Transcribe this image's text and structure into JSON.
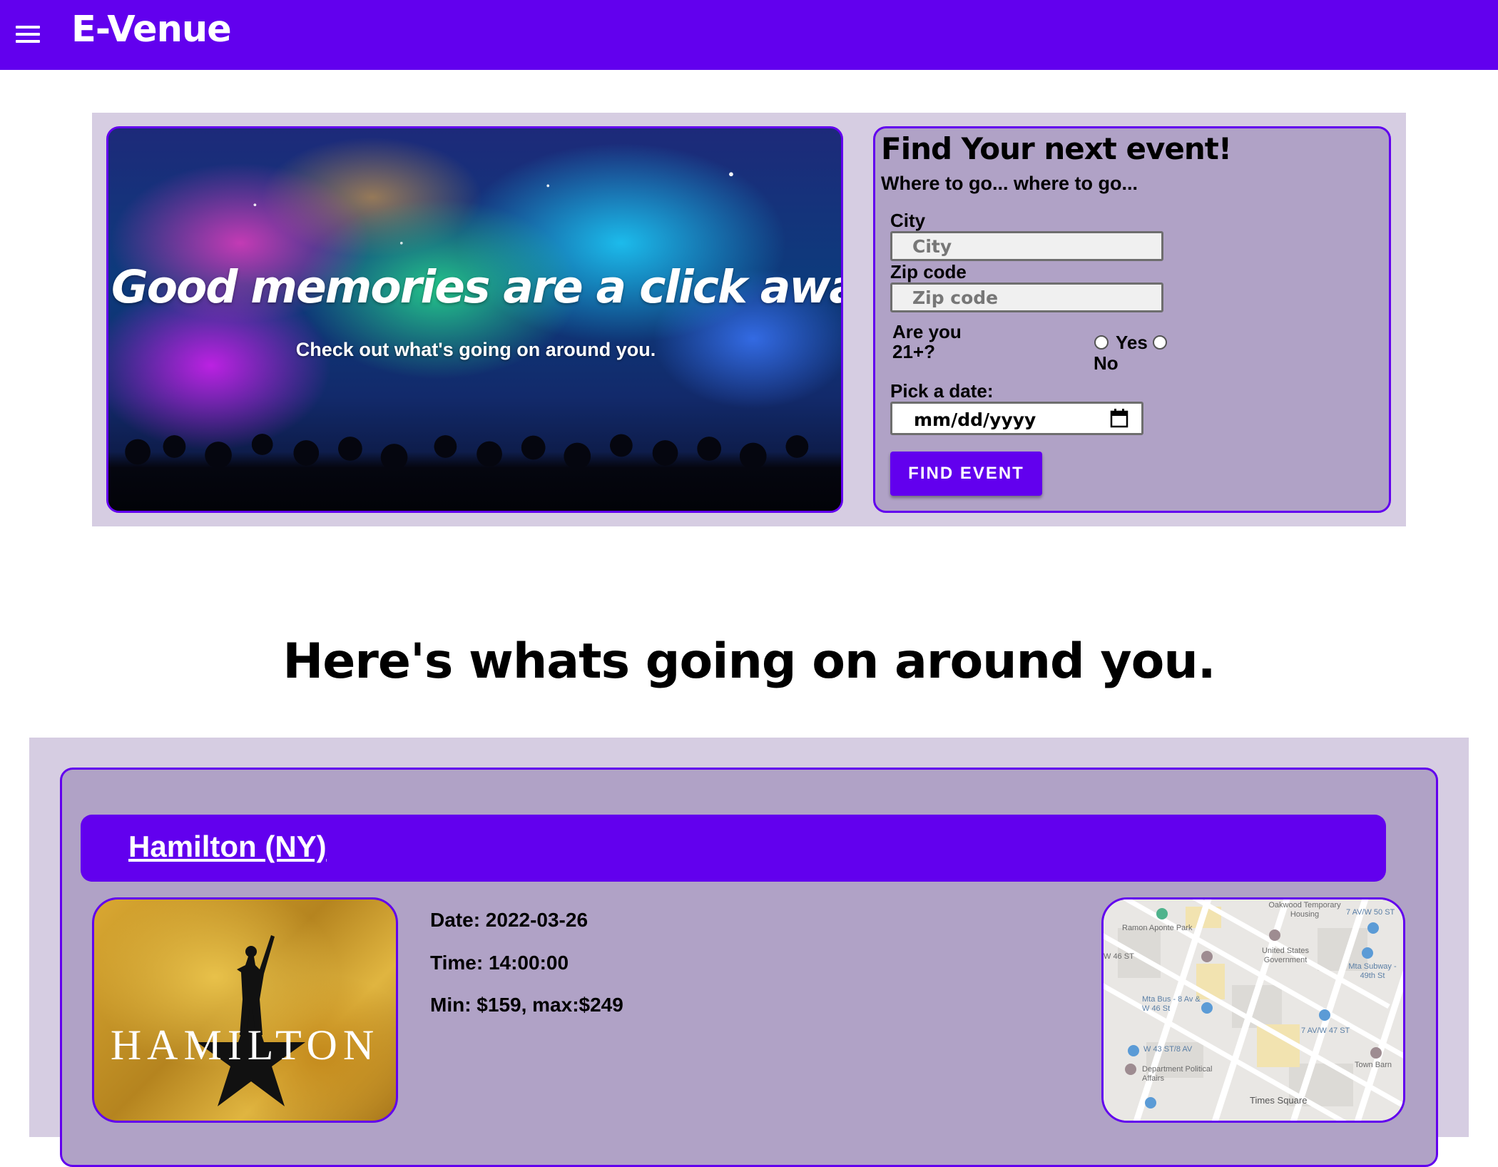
{
  "header": {
    "menu_icon": "menu-icon",
    "title": "E-Venue"
  },
  "hero": {
    "headline": "Good memories are a click away.",
    "subtext": "Check out what's going on around you."
  },
  "search": {
    "title": "Find Your next event!",
    "subtitle": "Where to go... where to go...",
    "city_label": "City",
    "city_placeholder": "City",
    "zip_label": "Zip code",
    "zip_placeholder": "Zip code",
    "age_question": "Are you 21+?",
    "age_yes": "Yes",
    "age_no": "No",
    "date_label": "Pick a date:",
    "date_placeholder": "mm/dd/yyyy",
    "calendar_icon": "calendar-icon",
    "button_label": "Find Event"
  },
  "section": {
    "heading": "Here's whats going on around you."
  },
  "events": [
    {
      "title": "Hamilton (NY)",
      "poster_text": "HAMILTON",
      "date": "Date: 2022-03-26",
      "time": "Time: 14:00:00",
      "price": "Min: $159, max:$249"
    }
  ],
  "map": {
    "labels": [
      "Oakwood Temporary Housing",
      "7 AV/W 50 ST",
      "Ramon Aponte Park",
      "W 46 ST",
      "United States Government",
      "Mta Subway - 49th St",
      "Mta Bus - 8 Av & W 46 St",
      "7 AV/W 47 ST",
      "W 43 ST/8 AV",
      "Department Political Affairs",
      "Town Barn",
      "Times Square"
    ]
  },
  "colors": {
    "primary": "#6200ee",
    "panel_bg": "#d6cde2",
    "card_bg": "#b0a2c6"
  }
}
